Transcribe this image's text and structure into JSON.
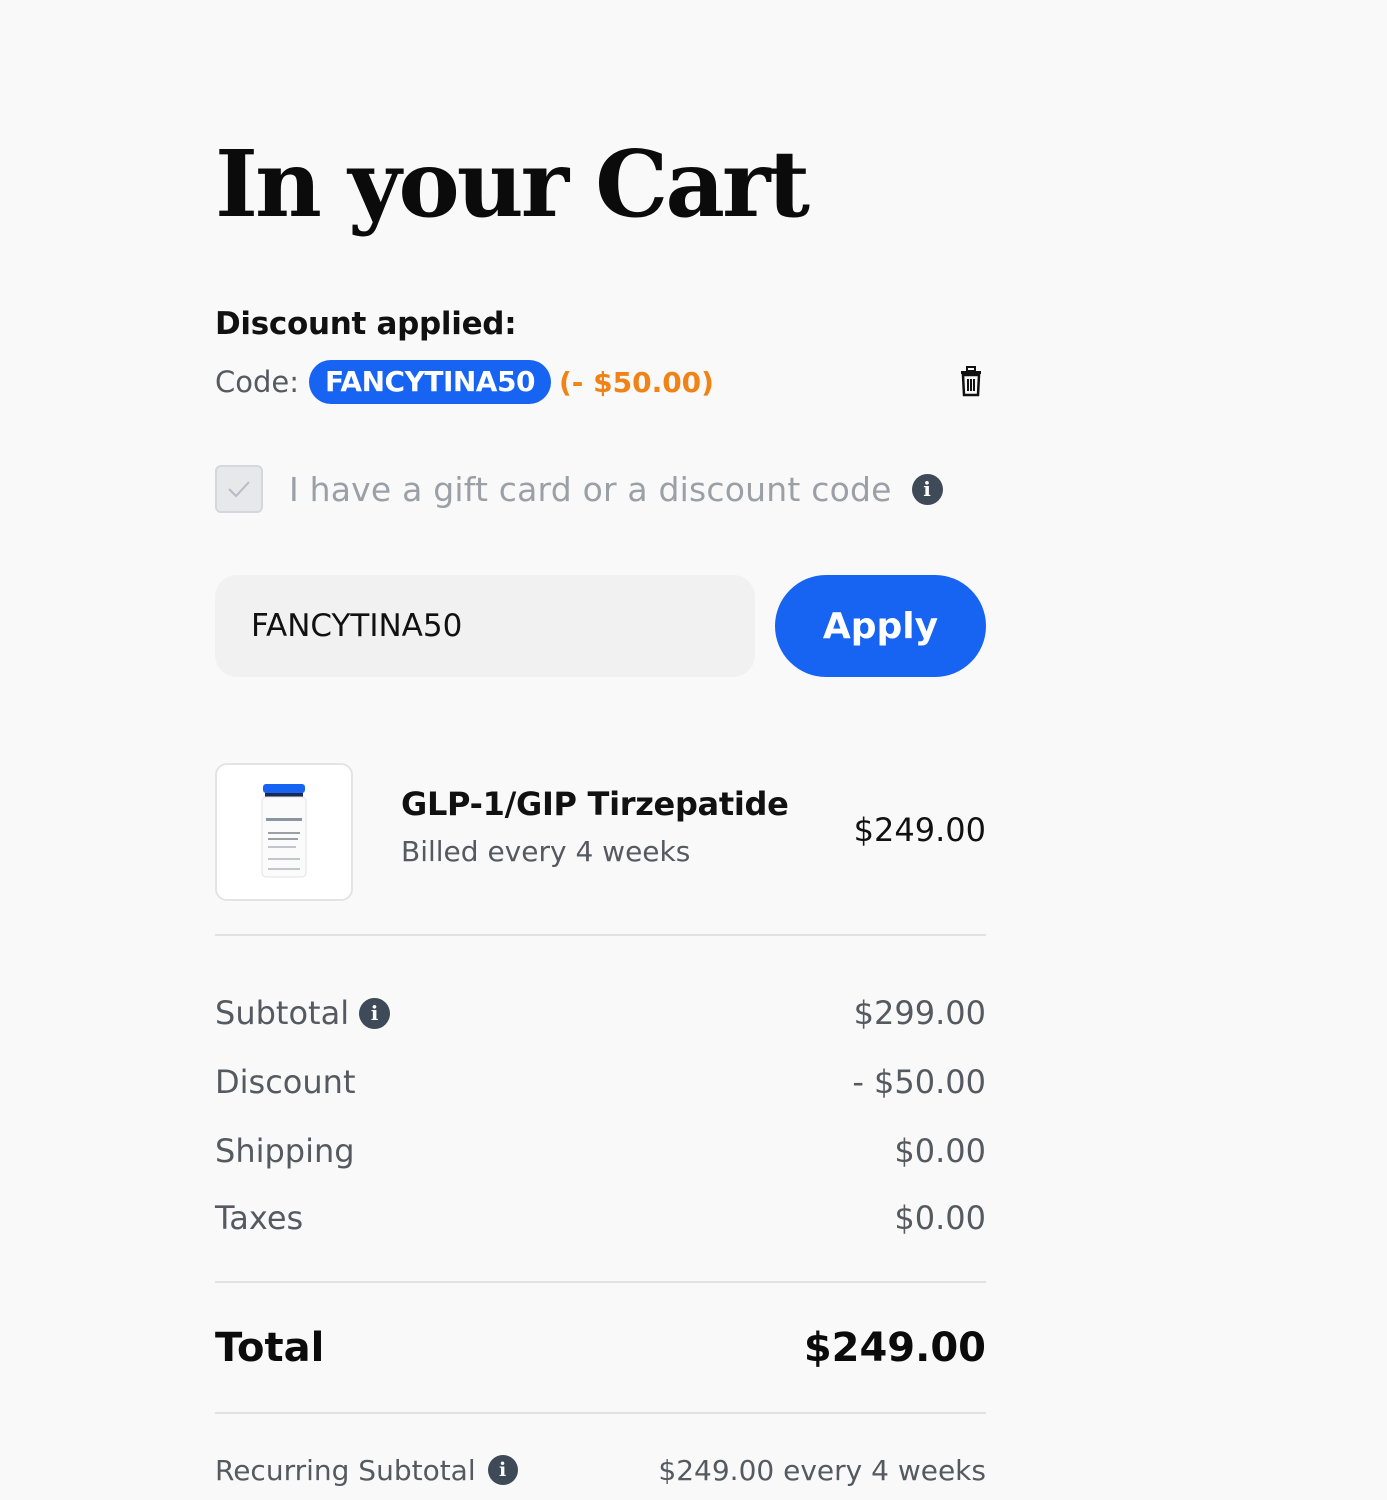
{
  "cart": {
    "title": "In your Cart"
  },
  "discount": {
    "heading": "Discount applied:",
    "code_label": "Code:",
    "code": "FANCYTINA50",
    "amount": "(- $50.00)"
  },
  "gift": {
    "checked": true,
    "label": "I have a gift card or a discount code"
  },
  "code_form": {
    "value": "FANCYTINA50",
    "apply_label": "Apply"
  },
  "product": {
    "name": "GLP-1/GIP Tirzepatide",
    "billing": "Billed every 4 weeks",
    "price": "$249.00"
  },
  "summary": {
    "subtotal_label": "Subtotal",
    "subtotal_value": "$299.00",
    "discount_label": "Discount",
    "discount_value": "- $50.00",
    "shipping_label": "Shipping",
    "shipping_value": "$0.00",
    "taxes_label": "Taxes",
    "taxes_value": "$0.00",
    "total_label": "Total",
    "total_value": "$249.00",
    "recurring_label": "Recurring Subtotal",
    "recurring_value": "$249.00 every 4 weeks"
  },
  "colors": {
    "accent": "#1763f2",
    "discount_orange": "#f08216",
    "background": "#f9f9f9"
  },
  "icons": {
    "delete": "trash-icon",
    "info": "info-icon",
    "check": "checkmark-icon"
  }
}
